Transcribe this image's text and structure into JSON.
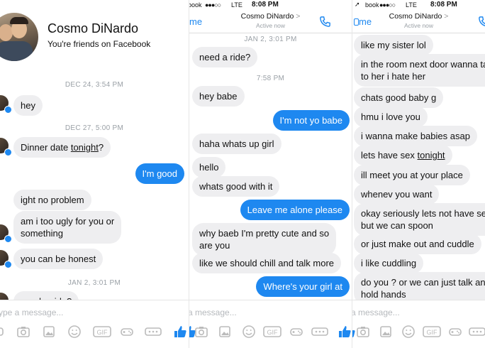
{
  "colors": {
    "outgoing": "#1e88f0",
    "incoming": "#eeeef0",
    "stamp": "#9aa0a6",
    "messenger_blue": "#1e88f0"
  },
  "panel1": {
    "profile": {
      "name": "Cosmo DiNardo",
      "subtitle": "You're friends on Facebook"
    },
    "messages": [
      {
        "type": "stamp",
        "text": "DEC 24, 3:54 PM"
      },
      {
        "type": "in",
        "text": "hey"
      },
      {
        "type": "stamp",
        "text": "DEC 27, 5:00 PM"
      },
      {
        "type": "in",
        "text_pre": "Dinner date ",
        "text_ul": "tonight",
        "text_post": "?"
      },
      {
        "type": "out",
        "text": "I'm good"
      },
      {
        "type": "in",
        "text": "ight no problem"
      },
      {
        "type": "in",
        "text1": "am i too  ugly for you or",
        "text2": "something"
      },
      {
        "type": "in",
        "text": "you can be honest"
      },
      {
        "type": "stamp",
        "text": "JAN 2, 3:01 PM"
      },
      {
        "type": "in",
        "text": "need a ride?"
      }
    ],
    "composer_placeholder": "ype a message..."
  },
  "panel2": {
    "status": {
      "left": "book",
      "network": "LTE",
      "time": "8:08 PM"
    },
    "nav": {
      "back": "me",
      "title": "Cosmo DiNardo",
      "chevron": ">",
      "sub": "Active now"
    },
    "messages": [
      {
        "type": "stamp",
        "text": "JAN 2, 3:01 PM"
      },
      {
        "type": "in",
        "text": "need a ride?"
      },
      {
        "type": "stamp",
        "text": "7:58 PM"
      },
      {
        "type": "in",
        "text": "hey babe"
      },
      {
        "type": "out",
        "text": "I'm not yo babe"
      },
      {
        "type": "in",
        "text": "haha whats up girl"
      },
      {
        "type": "in",
        "text": "hello"
      },
      {
        "type": "in",
        "text": "whats good with it"
      },
      {
        "type": "out",
        "text": "Leave me alone please"
      },
      {
        "type": "in",
        "text1": "why baeb I'm pretty cute and so",
        "text2": "are you"
      },
      {
        "type": "in",
        "text": "like we should chill and talk more"
      },
      {
        "type": "out",
        "text": "Where's your girl at"
      }
    ],
    "composer_placeholder": "a message..."
  },
  "panel3": {
    "status": {
      "left": "book",
      "network": "LTE",
      "time": "8:08 PM"
    },
    "nav": {
      "back": "me",
      "title": "Cosmo DiNardo",
      "chevron": ">",
      "sub": "Active now"
    },
    "messages": [
      {
        "type": "in",
        "text": "like my sister lol"
      },
      {
        "type": "in",
        "text1": "in the room next door wanna talk",
        "text2": "to her i hate her"
      },
      {
        "type": "in",
        "text": "chats good baby g"
      },
      {
        "type": "in",
        "text": "hmu i love you"
      },
      {
        "type": "in",
        "text": "i wanna make babies asap"
      },
      {
        "type": "in",
        "text_pre": "lets have sex ",
        "text_ul": "tonight",
        "text_post": ""
      },
      {
        "type": "in",
        "text": "ill meet you at your place"
      },
      {
        "type": "in",
        "text": "whenev you want"
      },
      {
        "type": "in",
        "text1": "okay seriously lets not have sex",
        "text2": "but we can spoon"
      },
      {
        "type": "in",
        "text": "or just make out and cuddle"
      },
      {
        "type": "in",
        "text": "i like cuddling"
      },
      {
        "type": "in",
        "text1": "do you ? or we can just talk and",
        "text2": "hold hands"
      }
    ],
    "composer_placeholder": "a message..."
  },
  "toolbar_icons": [
    "camera-icon",
    "photo-icon",
    "emoji-icon",
    "gif-icon",
    "game-icon",
    "more-icon",
    "like-icon"
  ],
  "gif_label": "GIF"
}
